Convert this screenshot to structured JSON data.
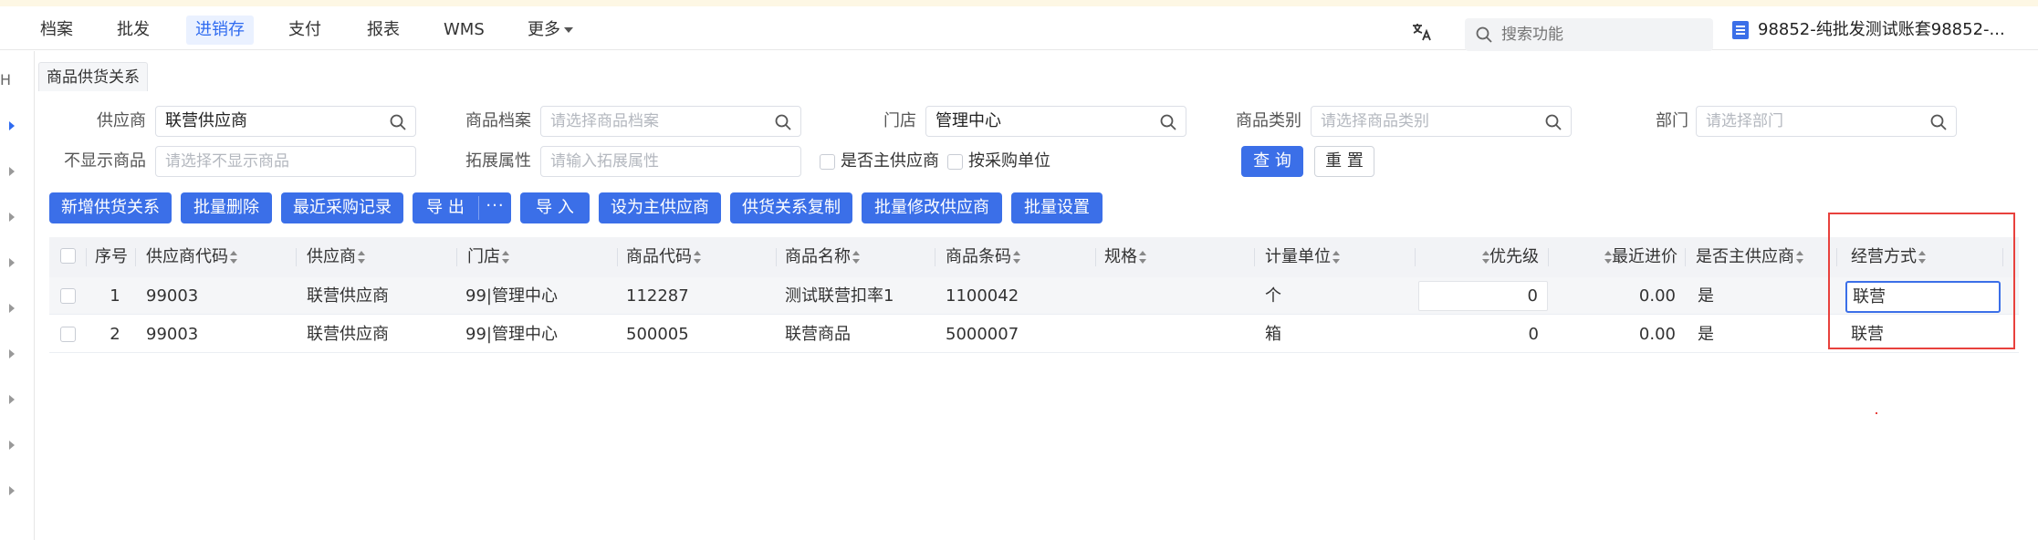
{
  "nav": {
    "items": [
      "档案",
      "批发",
      "进销存",
      "支付",
      "报表",
      "WMS",
      "更多"
    ],
    "search_placeholder": "搜索功能",
    "account": "98852-纯批发测试账套98852-..."
  },
  "rail": {
    "letter": "H"
  },
  "tab": {
    "label": "商品供货关系"
  },
  "filters": {
    "supplier": {
      "label": "供应商",
      "value": "联营供应商"
    },
    "product": {
      "label": "商品档案",
      "placeholder": "请选择商品档案"
    },
    "store": {
      "label": "门店",
      "value": "管理中心"
    },
    "category": {
      "label": "商品类别",
      "placeholder": "请选择商品类别"
    },
    "department": {
      "label": "部门",
      "placeholder": "请选择部门"
    },
    "hide_products": {
      "label": "不显示商品",
      "placeholder": "请选择不显示商品"
    },
    "ext_attr": {
      "label": "拓展属性",
      "placeholder": "请输入拓展属性"
    },
    "is_main_supplier": "是否主供应商",
    "by_purchase_unit": "按采购单位",
    "query": "查 询",
    "reset": "重 置"
  },
  "toolbar": {
    "add": "新增供货关系",
    "batch_delete": "批量删除",
    "recent_purchase": "最近采购记录",
    "export": "导 出",
    "more": "···",
    "import": "导 入",
    "set_main": "设为主供应商",
    "copy": "供货关系复制",
    "batch_modify": "批量修改供应商",
    "batch_settings": "批量设置"
  },
  "table": {
    "headers": {
      "seq": "序号",
      "supplier_code": "供应商代码",
      "supplier": "供应商",
      "store": "门店",
      "product_code": "商品代码",
      "product_name": "商品名称",
      "barcode": "商品条码",
      "spec": "规格",
      "unit": "计量单位",
      "priority": "优先级",
      "recent_price": "最近进价",
      "is_main": "是否主供应商",
      "mode": "经营方式"
    },
    "rows": [
      {
        "seq": "1",
        "supplier_code": "99003",
        "supplier": "联营供应商",
        "store": "99|管理中心",
        "product_code": "112287",
        "product_name": "测试联营扣率1",
        "barcode": "1100042",
        "spec": "",
        "unit": "个",
        "priority": "0",
        "recent_price": "0.00",
        "is_main": "是",
        "mode": "联营"
      },
      {
        "seq": "2",
        "supplier_code": "99003",
        "supplier": "联营供应商",
        "store": "99|管理中心",
        "product_code": "500005",
        "product_name": "联营商品",
        "barcode": "5000007",
        "spec": "",
        "unit": "箱",
        "priority": "0",
        "recent_price": "0.00",
        "is_main": "是",
        "mode": "联营"
      }
    ]
  }
}
